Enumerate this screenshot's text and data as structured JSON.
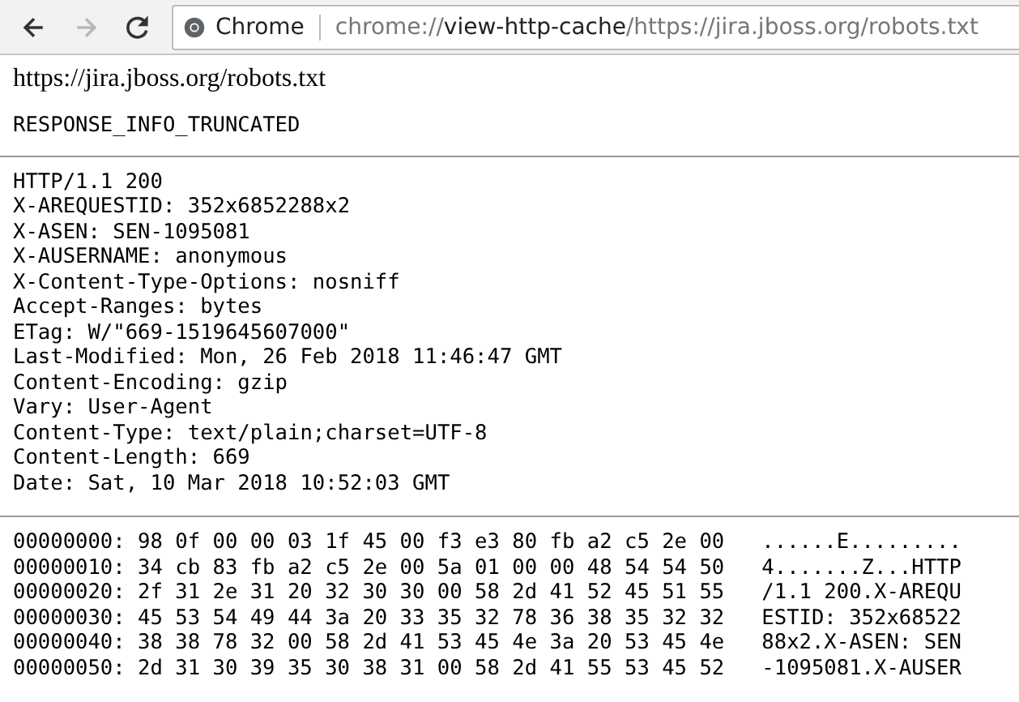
{
  "toolbar": {
    "buttons": [
      {
        "kind": "back",
        "disabled": false
      },
      {
        "kind": "forward",
        "disabled": true
      },
      {
        "kind": "reload",
        "disabled": false
      }
    ],
    "omnibox": {
      "chip": "Chrome",
      "url_scheme": "chrome://",
      "url_host": "view-http-cache",
      "url_path": "/https://jira.jboss.org/robots.txt"
    }
  },
  "page": {
    "heading": "https://jira.jboss.org/robots.txt",
    "notice": "RESPONSE_INFO_TRUNCATED",
    "headers": [
      "HTTP/1.1 200",
      "X-AREQUESTID: 352x6852288x2",
      "X-ASEN: SEN-1095081",
      "X-AUSERNAME: anonymous",
      "X-Content-Type-Options: nosniff",
      "Accept-Ranges: bytes",
      "ETag: W/\"669-1519645607000\"",
      "Last-Modified: Mon, 26 Feb 2018 11:46:47 GMT",
      "Content-Encoding: gzip",
      "Vary: User-Agent",
      "Content-Type: text/plain;charset=UTF-8",
      "Content-Length: 669",
      "Date: Sat, 10 Mar 2018 10:52:03 GMT"
    ],
    "hex_dump": [
      {
        "offset": "00000000:",
        "bytes": "98 0f 00 00 03 1f 45 00 f3 e3 80 fb a2 c5 2e 00",
        "ascii": "......E........."
      },
      {
        "offset": "00000010:",
        "bytes": "34 cb 83 fb a2 c5 2e 00 5a 01 00 00 48 54 54 50",
        "ascii": "4.......Z...HTTP"
      },
      {
        "offset": "00000020:",
        "bytes": "2f 31 2e 31 20 32 30 30 00 58 2d 41 52 45 51 55",
        "ascii": "/1.1 200.X-AREQU"
      },
      {
        "offset": "00000030:",
        "bytes": "45 53 54 49 44 3a 20 33 35 32 78 36 38 35 32 32",
        "ascii": "ESTID: 352x68522"
      },
      {
        "offset": "00000040:",
        "bytes": "38 38 78 32 00 58 2d 41 53 45 4e 3a 20 53 45 4e",
        "ascii": "88x2.X-ASEN: SEN"
      },
      {
        "offset": "00000050:",
        "bytes": "2d 31 30 39 35 30 38 31 00 58 2d 41 55 53 45 52",
        "ascii": "-1095081.X-AUSER"
      }
    ]
  }
}
